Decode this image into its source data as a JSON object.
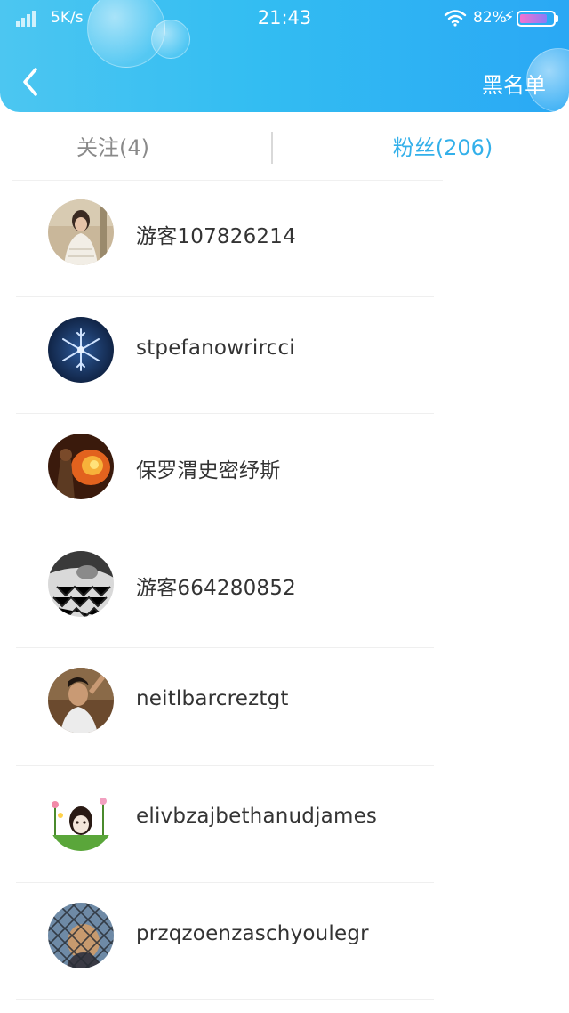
{
  "status_bar": {
    "network_speed": "5K/s",
    "time": "21:43",
    "battery_percent": "82%",
    "battery_level": 0.82
  },
  "header": {
    "back_icon": "chevron-left-icon",
    "blacklist_label": "黑名单"
  },
  "tabs": {
    "following_label": "关注(4)",
    "fans_label": "粉丝(206)",
    "active": "fans"
  },
  "colors": {
    "header_gradient_start": "#4cc6f1",
    "header_gradient_end": "#2aa8f4",
    "active_tab": "#33b0ea",
    "inactive_tab": "#8a8a8a",
    "username_text": "#333333"
  },
  "fans": [
    {
      "username": "游客107826214",
      "avatar": "woman-photo-avatar"
    },
    {
      "username": "stpefanowrircci",
      "avatar": "snowflake-avatar"
    },
    {
      "username": "保罗渭史密纾斯",
      "avatar": "fire-avatar"
    },
    {
      "username": "游客664280852",
      "avatar": "monochrome-pattern-avatar"
    },
    {
      "username": "neitlbarcreztgt",
      "avatar": "man-photo-avatar"
    },
    {
      "username": "elivbzajbethanudjames",
      "avatar": "cartoon-flowers-avatar"
    },
    {
      "username": "przqzoenzaschyoulegr",
      "avatar": "fence-photo-avatar"
    }
  ]
}
